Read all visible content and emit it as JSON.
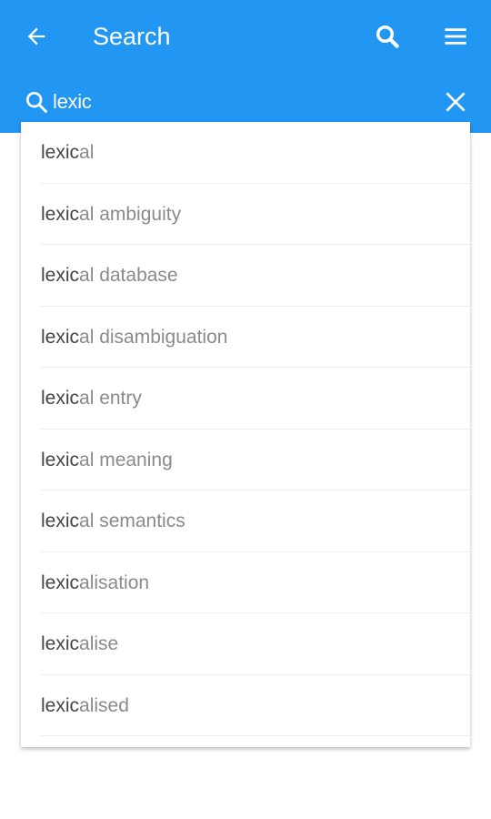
{
  "toolbar": {
    "title": "Search",
    "back_icon": "arrow-left-icon",
    "search_icon": "search-icon",
    "menu_icon": "hamburger-menu-icon"
  },
  "search": {
    "value": "lexic",
    "clear_icon": "close-icon",
    "icon": "search-icon"
  },
  "colors": {
    "header": "#2196f3",
    "match_text": "#444444",
    "rest_text": "#8a8a8a"
  },
  "suggestions": [
    {
      "match": "lexic",
      "rest": "al"
    },
    {
      "match": "lexic",
      "rest": "al ambiguity"
    },
    {
      "match": "lexic",
      "rest": "al database"
    },
    {
      "match": "lexic",
      "rest": "al disambiguation"
    },
    {
      "match": "lexic",
      "rest": "al entry"
    },
    {
      "match": "lexic",
      "rest": "al meaning"
    },
    {
      "match": "lexic",
      "rest": "al semantics"
    },
    {
      "match": "lexic",
      "rest": "alisation"
    },
    {
      "match": "lexic",
      "rest": "alise"
    },
    {
      "match": "lexic",
      "rest": "alised"
    }
  ]
}
